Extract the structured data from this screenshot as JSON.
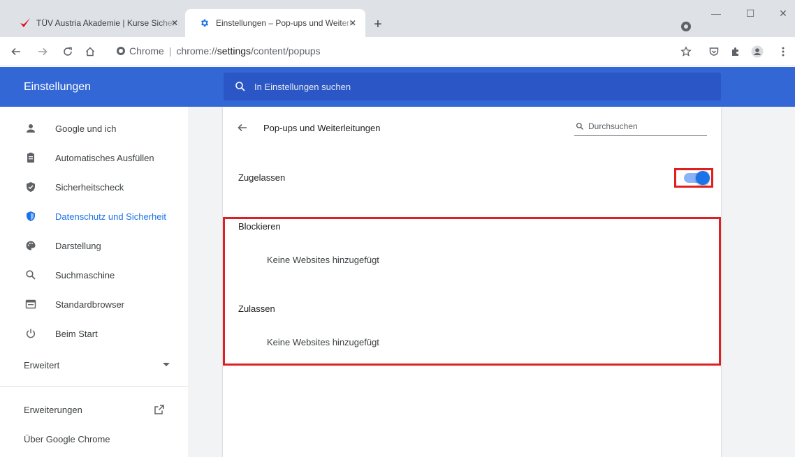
{
  "tabs": [
    {
      "title": "TÜV Austria Akademie | Kurse Sicherheit",
      "close": "✕",
      "active": false
    },
    {
      "title": "Einstellungen – Pop-ups und Weiterleitungen",
      "close": "✕",
      "active": true
    }
  ],
  "new_tab": "+",
  "window_controls": {
    "minimize": "—",
    "maximize": "☐",
    "close": "✕"
  },
  "omnibox": {
    "chip": "Chrome",
    "separator": "|",
    "scheme": "chrome://",
    "host": "settings",
    "path": "/content/popups"
  },
  "settings": {
    "title": "Einstellungen",
    "search_placeholder": "In Einstellungen suchen"
  },
  "sidebar": {
    "items": [
      {
        "label": "Google und ich",
        "icon": "person-icon"
      },
      {
        "label": "Automatisches Ausfüllen",
        "icon": "clipboard-icon"
      },
      {
        "label": "Sicherheitscheck",
        "icon": "shield-check-icon"
      },
      {
        "label": "Datenschutz und Sicherheit",
        "icon": "shield-icon",
        "active": true
      },
      {
        "label": "Darstellung",
        "icon": "palette-icon"
      },
      {
        "label": "Suchmaschine",
        "icon": "search-icon"
      },
      {
        "label": "Standardbrowser",
        "icon": "browser-icon"
      },
      {
        "label": "Beim Start",
        "icon": "power-icon"
      }
    ],
    "advanced": "Erweitert",
    "extensions": "Erweiterungen",
    "about": "Über Google Chrome"
  },
  "page": {
    "title": "Pop-ups und Weiterleitungen",
    "search_placeholder": "Durchsuchen",
    "allowed_label": "Zugelassen",
    "allowed_enabled": true,
    "block_heading": "Blockieren",
    "block_empty": "Keine Websites hinzugefügt",
    "allow_heading": "Zulassen",
    "allow_empty": "Keine Websites hinzugefügt"
  },
  "colors": {
    "accent": "#1a73e8",
    "header": "#3367d6",
    "highlight": "#e02020"
  }
}
